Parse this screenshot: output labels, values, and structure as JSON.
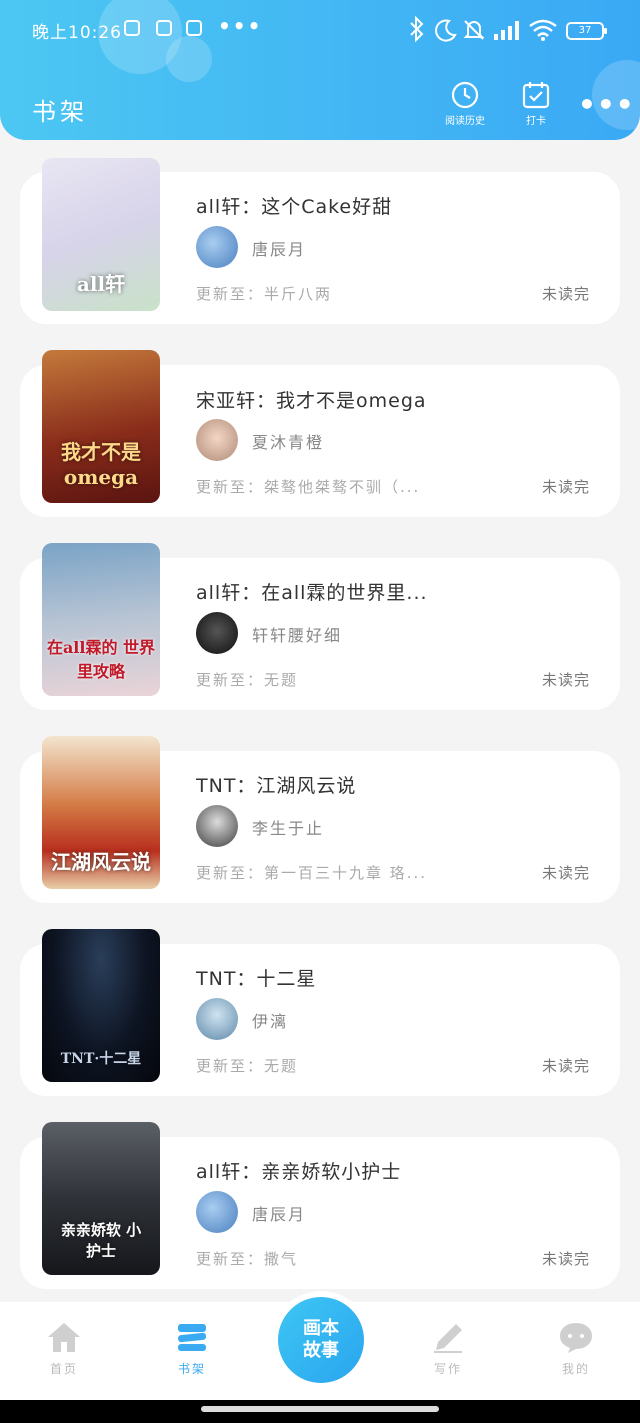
{
  "status_bar": {
    "time": "晚上10:26",
    "dots": "•••",
    "battery": "37",
    "icons": [
      "bluetooth-icon",
      "moon-icon",
      "mute-icon",
      "signal-icon",
      "wifi-icon",
      "battery-icon"
    ]
  },
  "header": {
    "title": "书架",
    "history_label": "阅读历史",
    "checkin_label": "打卡",
    "more_label": "•••",
    "colors": {
      "gradient_start": "#4cc7f2",
      "gradient_end": "#3aa9f5"
    }
  },
  "books": [
    {
      "title": "all轩：这个Cake好甜",
      "author": "唐辰月",
      "update": "更新至：半斤八两",
      "status": "未读完",
      "cover_text": "all轩"
    },
    {
      "title": "宋亚轩：我才不是omega",
      "author": "夏沐青橙",
      "update": "更新至：桀骜他桀骜不驯（...",
      "status": "未读完",
      "cover_text": "我才不是 omega"
    },
    {
      "title": "all轩：在all霖的世界里...",
      "author": "轩轩腰好细",
      "update": "更新至：无题",
      "status": "未读完",
      "cover_text": "在all霖的 世界里攻略"
    },
    {
      "title": "TNT：江湖风云说",
      "author": "李生于止",
      "update": "更新至：第一百三十九章 珞...",
      "status": "未读完",
      "cover_text": "江湖风云说"
    },
    {
      "title": "TNT：十二星",
      "author": "伊漓",
      "update": "更新至：无题",
      "status": "未读完",
      "cover_text": "TNT·十二星"
    },
    {
      "title": "all轩：亲亲娇软小护士",
      "author": "唐辰月",
      "update": "更新至：撒气",
      "status": "未读完",
      "cover_text": "亲亲娇软 小护士"
    }
  ],
  "tabbar": {
    "home": "首页",
    "bookshelf": "书架",
    "center_line1": "画本",
    "center_line2": "故事",
    "write": "写作",
    "mine": "我的",
    "active_color": "#3aaaf2"
  }
}
